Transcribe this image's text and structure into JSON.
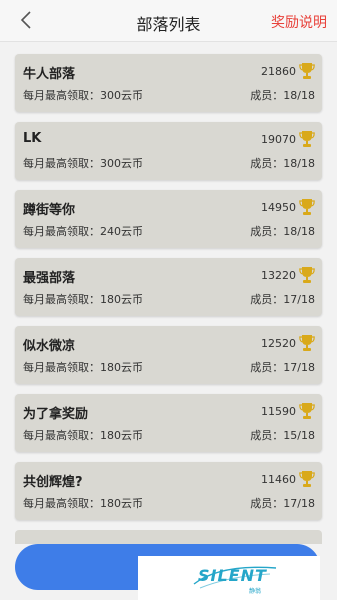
{
  "header": {
    "title": "部落列表",
    "reward_link": "奖励说明",
    "back_icon": "chevron-left-icon",
    "accent": "#e8413a"
  },
  "tribes": [
    {
      "name": "牛人部落",
      "limit": "每月最高领取：300云币",
      "score": "21860",
      "members": "成员：18/18"
    },
    {
      "name": "LK",
      "limit": "每月最高领取：300云币",
      "score": "19070",
      "members": "成员：18/18"
    },
    {
      "name": "蹲街等你",
      "limit": "每月最高领取：240云币",
      "score": "14950",
      "members": "成员：18/18"
    },
    {
      "name": "最强部落",
      "limit": "每月最高领取：180云币",
      "score": "13220",
      "members": "成员：17/18"
    },
    {
      "name": "似水微凉",
      "limit": "每月最高领取：180云币",
      "score": "12520",
      "members": "成员：17/18"
    },
    {
      "name": "为了拿奖励",
      "limit": "每月最高领取：180云币",
      "score": "11590",
      "members": "成员：15/18"
    },
    {
      "name": "共创辉煌?",
      "limit": "每月最高领取：180云币",
      "score": "11460",
      "members": "成员：17/18"
    }
  ],
  "trophy_icon": "trophy-icon",
  "trophy_color": "#d9a91a",
  "card_color": "#d9d8d2",
  "bottom_button": {
    "label": "",
    "color": "#3e7de8"
  },
  "watermark": {
    "text": "SILENT",
    "sub": "静翁",
    "color": "#25a6c9"
  }
}
